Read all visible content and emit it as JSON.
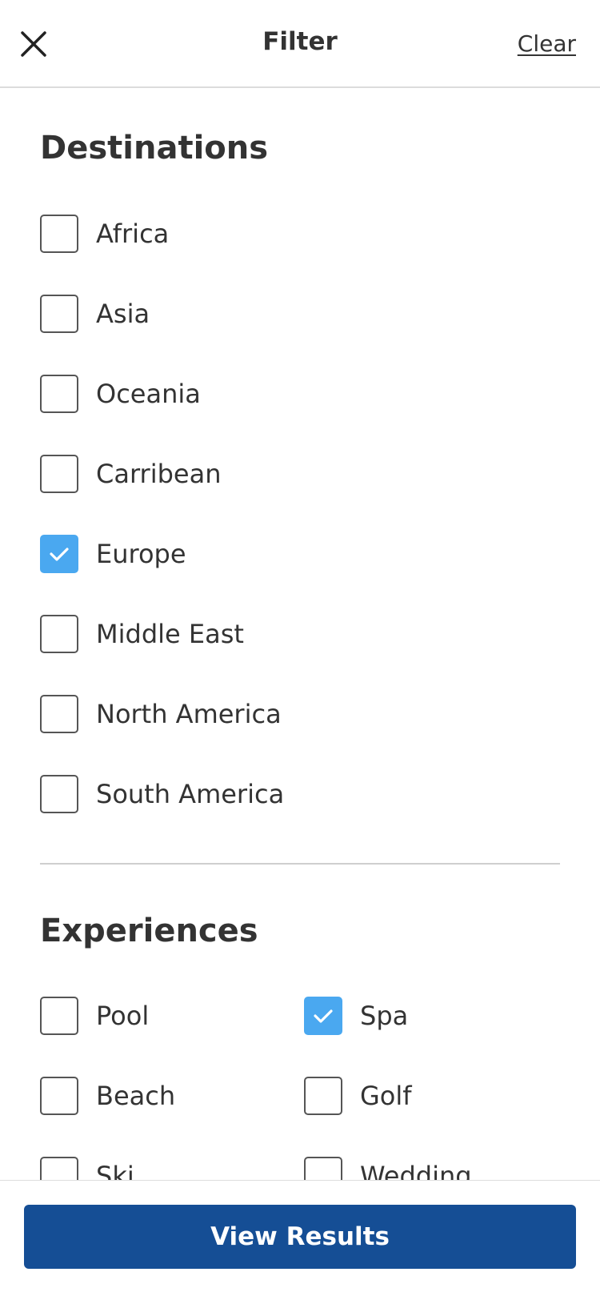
{
  "header": {
    "title": "Filter",
    "clear_label": "Clear",
    "close_icon": "close-icon"
  },
  "destinations": {
    "title": "Destinations",
    "options": [
      {
        "label": "Africa",
        "checked": false
      },
      {
        "label": "Asia",
        "checked": false
      },
      {
        "label": "Oceania",
        "checked": false
      },
      {
        "label": "Carribean",
        "checked": false
      },
      {
        "label": "Europe",
        "checked": true
      },
      {
        "label": "Middle East",
        "checked": false
      },
      {
        "label": "North America",
        "checked": false
      },
      {
        "label": "South America",
        "checked": false
      }
    ]
  },
  "experiences": {
    "title": "Experiences",
    "options": [
      {
        "label": "Pool",
        "checked": false
      },
      {
        "label": "Spa",
        "checked": true
      },
      {
        "label": "Beach",
        "checked": false
      },
      {
        "label": "Golf",
        "checked": false
      },
      {
        "label": "Ski",
        "checked": false
      },
      {
        "label": "Wedding",
        "checked": false
      }
    ]
  },
  "footer": {
    "view_results_label": "View Results"
  },
  "colors": {
    "checkbox_checked": "#4aa8f0",
    "primary_button": "#154e95",
    "text": "#333333"
  }
}
